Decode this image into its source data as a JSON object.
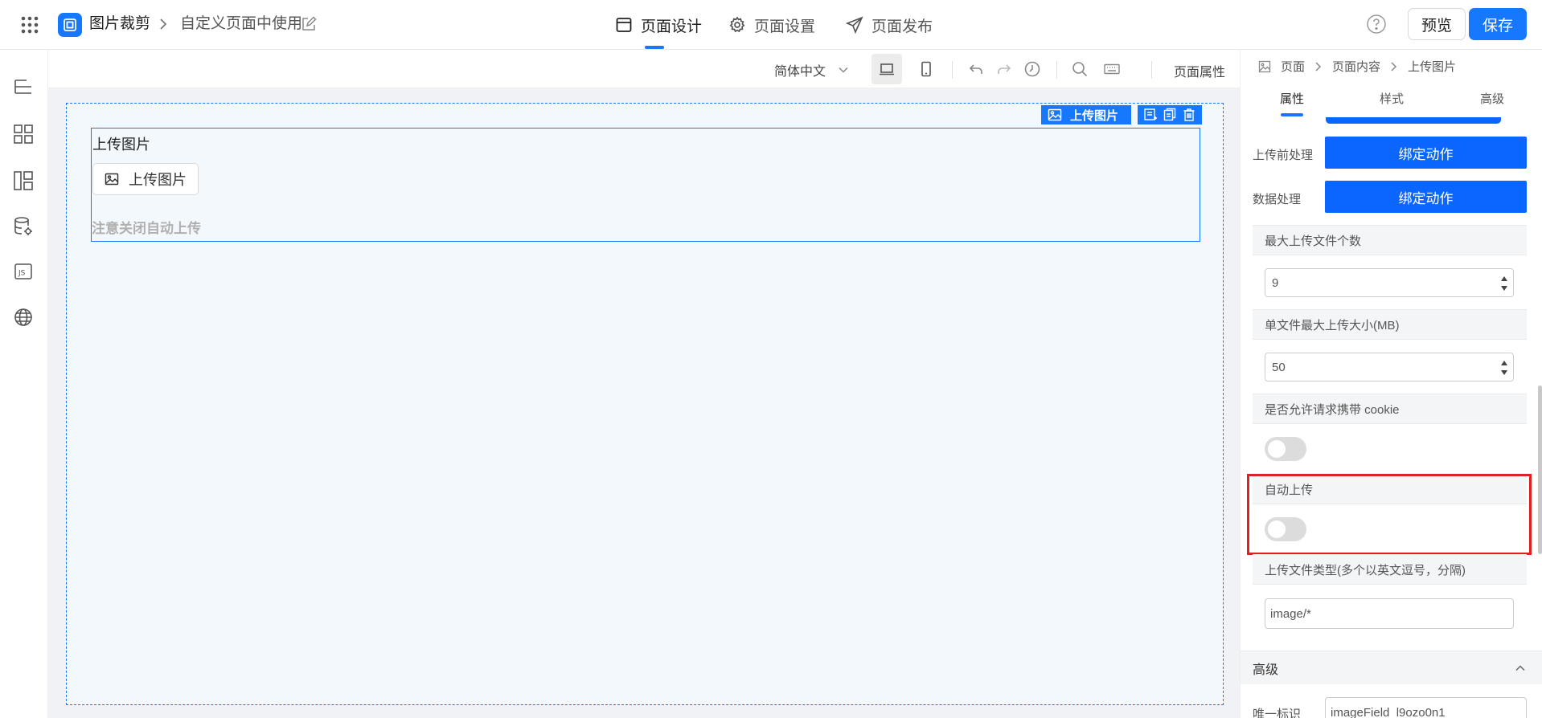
{
  "header": {
    "app_name": "图片裁剪",
    "page_name": "自定义页面中使用",
    "tabs": [
      {
        "label": "页面设计",
        "icon": "browser-window-icon"
      },
      {
        "label": "页面设置",
        "icon": "gear-icon"
      },
      {
        "label": "页面发布",
        "icon": "send-icon"
      }
    ],
    "preview_label": "预览",
    "save_label": "保存"
  },
  "left_rail": {
    "icons": [
      "outline-tree-icon",
      "components-grid-icon",
      "layout-icon",
      "data-source-icon",
      "js-script-icon",
      "globe-icon"
    ]
  },
  "canvas_toolbar": {
    "language": "简体中文",
    "page_properties": "页面属性"
  },
  "canvas": {
    "component_title": "上传图片",
    "upload_button_label": "上传图片",
    "hint": "注意关闭自动上传",
    "selected_tag": "上传图片"
  },
  "right_panel": {
    "breadcrumb": [
      "页面",
      "页面内容",
      "上传图片"
    ],
    "tabs": [
      "属性",
      "样式",
      "高级"
    ],
    "before_upload_label": "上传前处理",
    "data_process_label": "数据处理",
    "bind_action_label": "绑定动作",
    "max_files_label": "最大上传文件个数",
    "max_files_value": "9",
    "max_size_label": "单文件最大上传大小(MB)",
    "max_size_value": "50",
    "cookie_label": "是否允许请求携带 cookie",
    "cookie_enabled": false,
    "auto_upload_label": "自动上传",
    "auto_upload_enabled": false,
    "file_types_label": "上传文件类型(多个以英文逗号，分隔)",
    "file_types_value": "image/*",
    "advanced_label": "高级",
    "unique_id_label": "唯一标识",
    "unique_id_value": "imageField_l9ozo0n1"
  },
  "colors": {
    "primary": "#1677ff",
    "bind_button": "#0a66ff",
    "highlight": "#e02020"
  }
}
